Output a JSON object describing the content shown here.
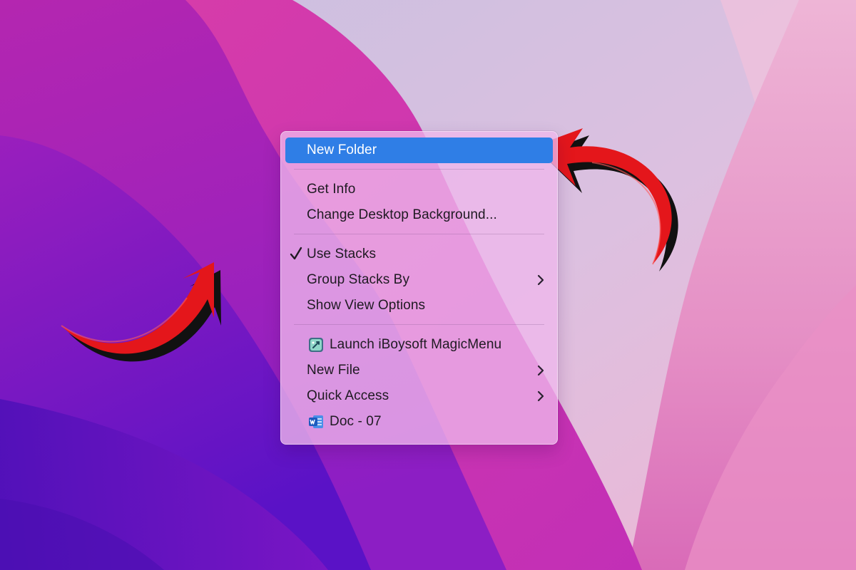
{
  "desktop": {
    "wallpaper": "macOS Monterey purple-pink wave wallpaper"
  },
  "annotations": {
    "arrow_color": "#e4161b",
    "arrow_shadow_color": "#111111"
  },
  "context_menu": {
    "highlight_color": "#2f7ee6",
    "groups": [
      [
        {
          "label": "New Folder",
          "highlighted": true
        }
      ],
      [
        {
          "label": "Get Info"
        },
        {
          "label": "Change Desktop Background..."
        }
      ],
      [
        {
          "label": "Use Stacks",
          "checked": true
        },
        {
          "label": "Group Stacks By",
          "submenu": true
        },
        {
          "label": "Show View Options"
        }
      ],
      [
        {
          "label": "Launch iBoysoft MagicMenu",
          "icon": "magicmenu-icon"
        },
        {
          "label": "New File",
          "submenu": true
        },
        {
          "label": "Quick Access",
          "submenu": true
        },
        {
          "label": "Doc - 07",
          "icon": "word-document-icon"
        }
      ]
    ]
  }
}
